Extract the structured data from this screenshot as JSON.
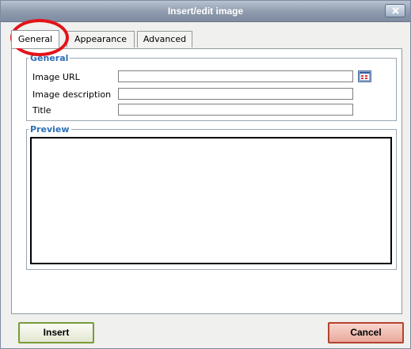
{
  "window": {
    "title": "Insert/edit image",
    "close_icon": "close-icon"
  },
  "tabs": [
    {
      "label": "General",
      "active": true
    },
    {
      "label": "Appearance",
      "active": false
    },
    {
      "label": "Advanced",
      "active": false
    }
  ],
  "general": {
    "legend": "General",
    "fields": [
      {
        "label": "Image URL",
        "value": ""
      },
      {
        "label": "Image description",
        "value": ""
      },
      {
        "label": "Title",
        "value": ""
      }
    ],
    "browse_icon": "browse-icon"
  },
  "preview": {
    "legend": "Preview"
  },
  "buttons": {
    "insert": "Insert",
    "cancel": "Cancel"
  },
  "annotation": {
    "color": "#e2141a",
    "target": "General tab"
  }
}
